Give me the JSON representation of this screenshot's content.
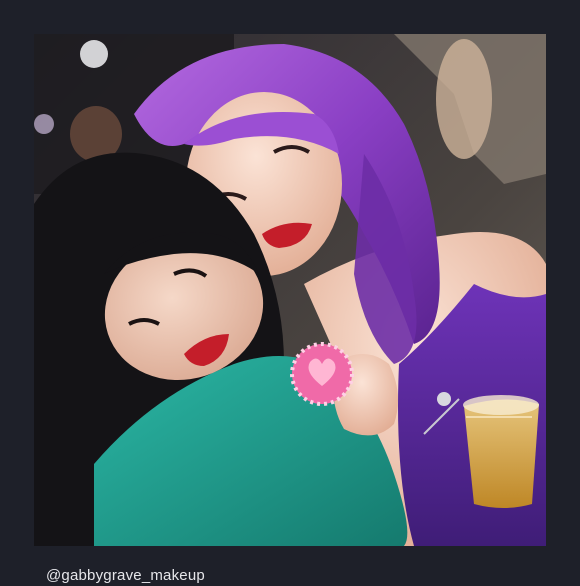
{
  "post": {
    "caption_handle": "@gabbygrave_makeup"
  },
  "photo": {
    "subjects": [
      "woman-dark-hair",
      "woman-purple-hair"
    ],
    "colors": {
      "background": "#1e2029",
      "purple_hair": "#8a3fc4",
      "purple_dress": "#5b2a9e",
      "teal_top": "#1f9e8f",
      "dark_hair": "#141316",
      "skin": "#e8c3b0",
      "lips": "#c41e2a",
      "cookie": "#f06aa8",
      "drink": "#e2b23a"
    }
  }
}
